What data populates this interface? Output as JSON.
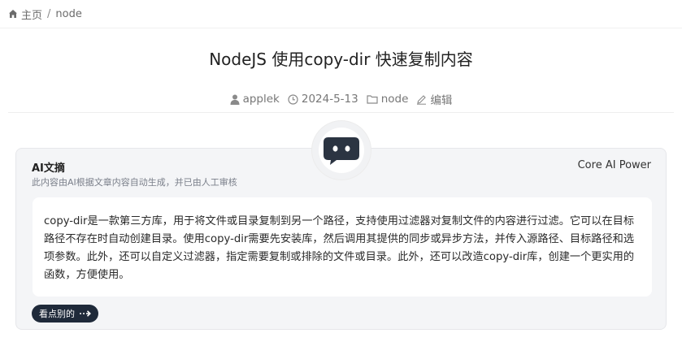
{
  "breadcrumb": {
    "home": "主页",
    "separator": "/",
    "current": "node"
  },
  "post": {
    "title": "NodeJS 使用copy-dir 快速复制内容",
    "author": "applek",
    "date": "2024-5-13",
    "category": "node",
    "edit": "编辑"
  },
  "ai_summary": {
    "title": "AI文摘",
    "subtitle": "此内容由AI根据文章内容自动生成，并已由人工审核",
    "power": "Core AI Power",
    "content": "copy-dir是一款第三方库，用于将文件或目录复制到另一个路径，支持使用过滤器对复制文件的内容进行过滤。它可以在目标路径不存在时自动创建目录。使用copy-dir需要先安装库，然后调用其提供的同步或异步方法，并传入源路径、目标路径和选项参数。此外，还可以自定义过滤器，指定需要复制或排除的文件或目录。此外，还可以改造copy-dir库，创建一个更实用的函数，方便使用。",
    "button": "看点别的"
  },
  "icons": {
    "home": "home-icon",
    "author": "user-icon",
    "date": "clock-icon",
    "category": "folder-icon",
    "edit": "pencil-icon",
    "bot": "robot-icon",
    "arrow": "arrow-right-icon"
  }
}
